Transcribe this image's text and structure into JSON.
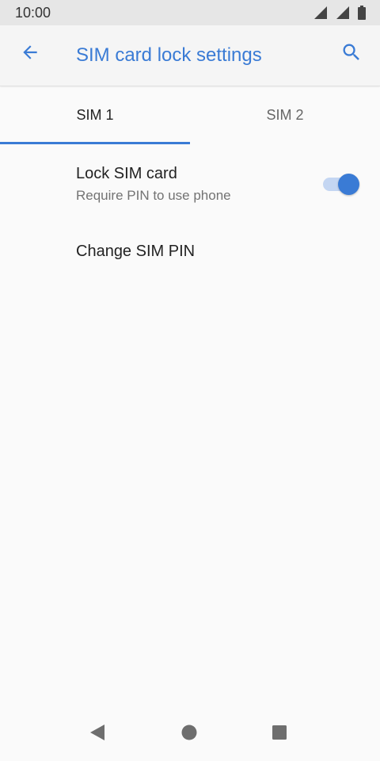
{
  "status_bar": {
    "time": "10:00",
    "icons": [
      "signal-icon",
      "signal-icon",
      "battery-icon"
    ]
  },
  "app_bar": {
    "title": "SIM card lock settings",
    "back_icon": "back-arrow-icon",
    "search_icon": "search-icon",
    "accent_color": "#3a7bd5"
  },
  "tabs": [
    {
      "label": "SIM 1",
      "selected": true
    },
    {
      "label": "SIM 2",
      "selected": false
    }
  ],
  "settings": {
    "lock_sim": {
      "title": "Lock SIM card",
      "subtitle": "Require PIN to use phone",
      "enabled": true
    },
    "change_pin": {
      "title": "Change SIM PIN"
    }
  },
  "nav_bar": {
    "buttons": [
      "back-triangle-icon",
      "home-circle-icon",
      "recents-square-icon"
    ]
  }
}
